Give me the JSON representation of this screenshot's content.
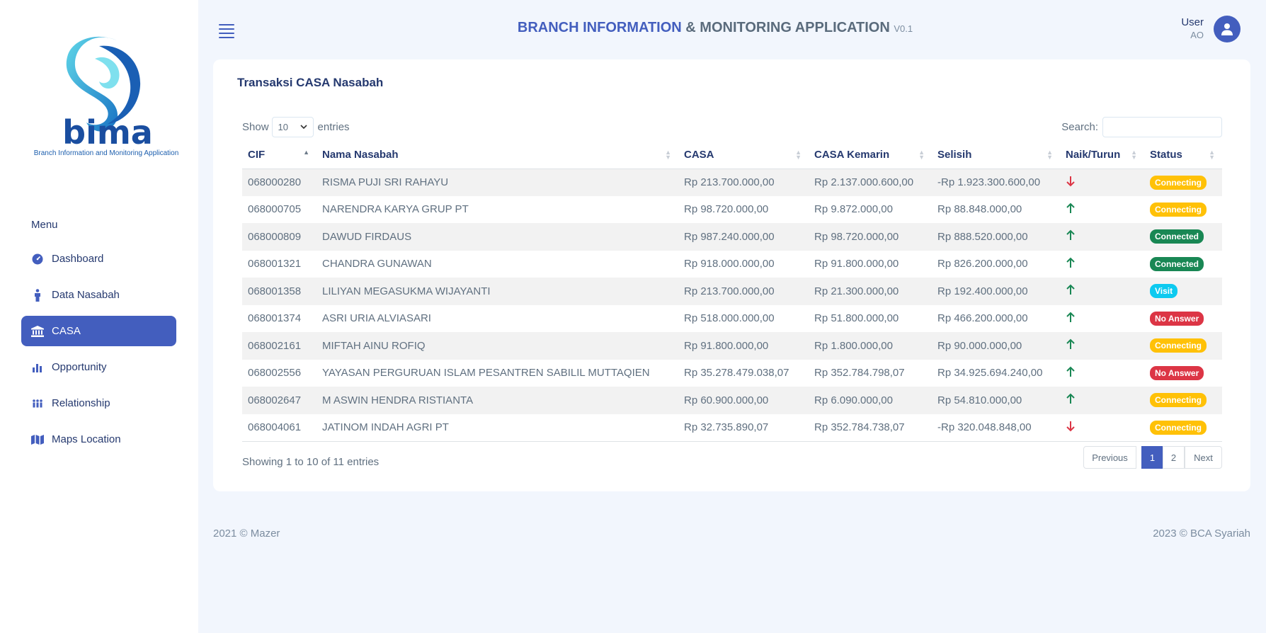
{
  "app": {
    "title_part1": "BRANCH INFORMATION",
    "title_part2": "& MONITORING APPLICATION",
    "version": "V0.1",
    "logo_text": "bima",
    "logo_tagline": "Branch Information and Monitoring Application"
  },
  "user": {
    "name": "User",
    "role": "AO"
  },
  "sidebar": {
    "menu_title": "Menu",
    "items": [
      {
        "label": "Dashboard",
        "icon": "speedometer-icon",
        "active": false
      },
      {
        "label": "Data Nasabah",
        "icon": "person-icon",
        "active": false
      },
      {
        "label": "CASA",
        "icon": "bank-icon",
        "active": true
      },
      {
        "label": "Opportunity",
        "icon": "bar-chart-icon",
        "active": false
      },
      {
        "label": "Relationship",
        "icon": "people-icon",
        "active": false
      },
      {
        "label": "Maps Location",
        "icon": "map-icon",
        "active": false
      }
    ]
  },
  "card": {
    "title": "Transaksi CASA Nasabah",
    "show_label": "Show",
    "page_size": "10",
    "entries_label": "entries",
    "search_label": "Search:",
    "search_value": ""
  },
  "table": {
    "headers": [
      "CIF",
      "Nama Nasabah",
      "CASA",
      "CASA Kemarin",
      "Selisih",
      "Naik/Turun",
      "Status"
    ],
    "rows": [
      {
        "cif": "068000280",
        "nama": "RISMA PUJI SRI RAHAYU",
        "casa": "Rp 213.700.000,00",
        "kemarin": "Rp 2.137.000.600,00",
        "selisih": "-Rp 1.923.300.600,00",
        "trend": "down",
        "status": "Connecting"
      },
      {
        "cif": "068000705",
        "nama": "NARENDRA KARYA GRUP PT",
        "casa": "Rp 98.720.000,00",
        "kemarin": "Rp 9.872.000,00",
        "selisih": "Rp 88.848.000,00",
        "trend": "up",
        "status": "Connecting"
      },
      {
        "cif": "068000809",
        "nama": "DAWUD FIRDAUS",
        "casa": "Rp 987.240.000,00",
        "kemarin": "Rp 98.720.000,00",
        "selisih": "Rp 888.520.000,00",
        "trend": "up",
        "status": "Connected"
      },
      {
        "cif": "068001321",
        "nama": "CHANDRA GUNAWAN",
        "casa": "Rp 918.000.000,00",
        "kemarin": "Rp 91.800.000,00",
        "selisih": "Rp 826.200.000,00",
        "trend": "up",
        "status": "Connected"
      },
      {
        "cif": "068001358",
        "nama": "LILIYAN MEGASUKMA WIJAYANTI",
        "casa": "Rp 213.700.000,00",
        "kemarin": "Rp 21.300.000,00",
        "selisih": "Rp 192.400.000,00",
        "trend": "up",
        "status": "Visit"
      },
      {
        "cif": "068001374",
        "nama": "ASRI URIA ALVIASARI",
        "casa": "Rp 518.000.000,00",
        "kemarin": "Rp 51.800.000,00",
        "selisih": "Rp 466.200.000,00",
        "trend": "up",
        "status": "No Answer"
      },
      {
        "cif": "068002161",
        "nama": "MIFTAH AINU ROFIQ",
        "casa": "Rp 91.800.000,00",
        "kemarin": "Rp 1.800.000,00",
        "selisih": "Rp 90.000.000,00",
        "trend": "up",
        "status": "Connecting"
      },
      {
        "cif": "068002556",
        "nama": "YAYASAN PERGURUAN ISLAM PESANTREN SABILIL MUTTAQIEN",
        "casa": "Rp 35.278.479.038,07",
        "kemarin": "Rp 352.784.798,07",
        "selisih": "Rp 34.925.694.240,00",
        "trend": "up",
        "status": "No Answer"
      },
      {
        "cif": "068002647",
        "nama": "M ASWIN HENDRA RISTIANTA",
        "casa": "Rp 60.900.000,00",
        "kemarin": "Rp 6.090.000,00",
        "selisih": "Rp 54.810.000,00",
        "trend": "up",
        "status": "Connecting"
      },
      {
        "cif": "068004061",
        "nama": "JATINOM INDAH AGRI PT",
        "casa": "Rp 32.735.890,07",
        "kemarin": "Rp 352.784.738,07",
        "selisih": "-Rp 320.048.848,00",
        "trend": "down",
        "status": "Connecting"
      }
    ]
  },
  "status_colors": {
    "Connecting": {
      "bg": "#ffc107",
      "fg": "#ffffff"
    },
    "Connected": {
      "bg": "#198754",
      "fg": "#ffffff"
    },
    "Visit": {
      "bg": "#0dcaf0",
      "fg": "#ffffff"
    },
    "No Answer": {
      "bg": "#dc3545",
      "fg": "#ffffff"
    }
  },
  "trend_colors": {
    "up": "#198754",
    "down": "#dc3545"
  },
  "pagination": {
    "info": "Showing 1 to 10 of 11 entries",
    "previous": "Previous",
    "pages": [
      "1",
      "2"
    ],
    "active_page": "1",
    "next": "Next"
  },
  "footer": {
    "left": "2021 © Mazer",
    "right": "2023 © BCA Syariah"
  },
  "colors": {
    "accent": "#435ebe",
    "background": "#f2f6fd"
  }
}
